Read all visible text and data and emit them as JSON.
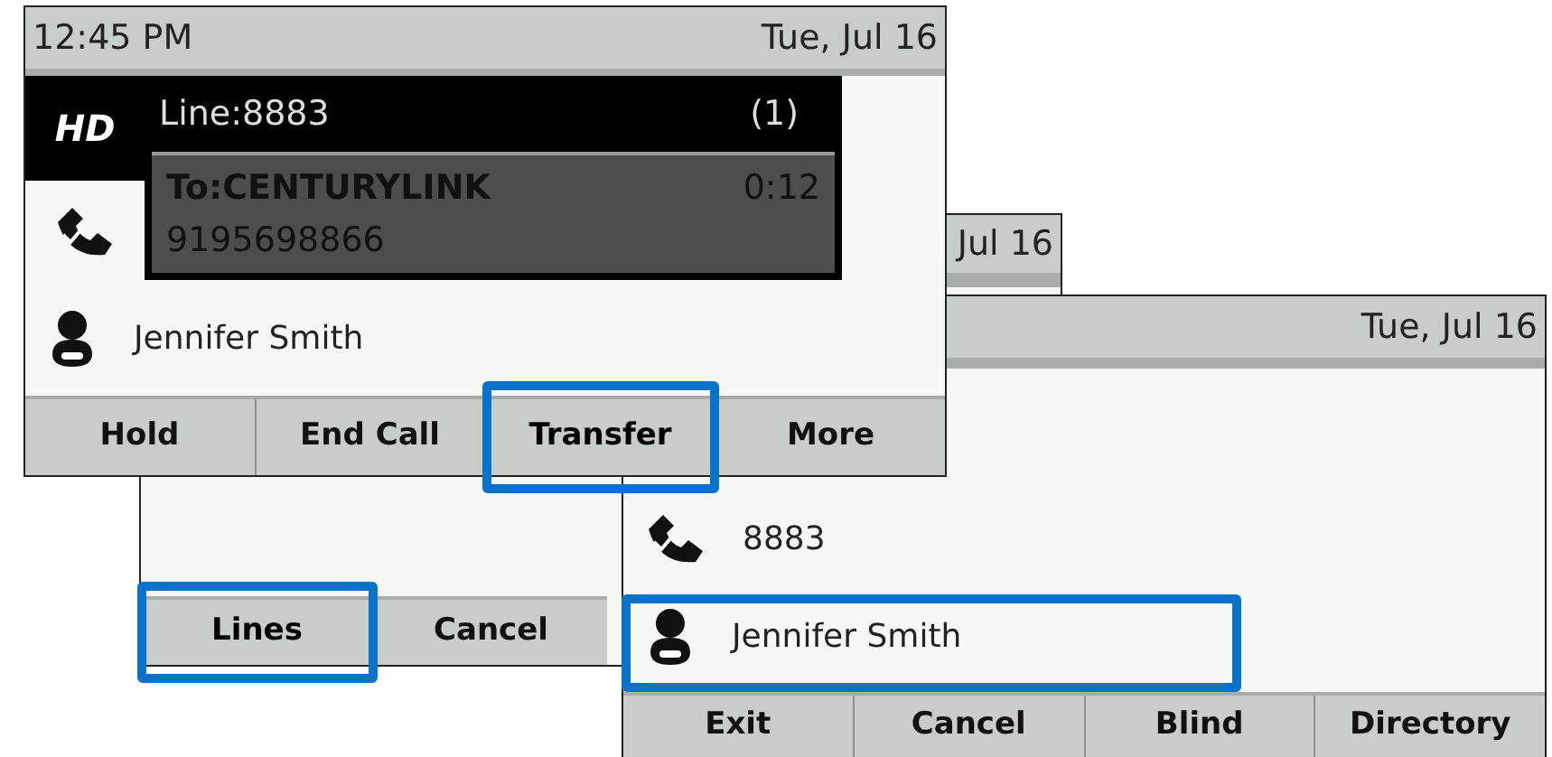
{
  "screens": [
    {
      "kind": "back",
      "header": {
        "date": "Jul 16"
      },
      "softkeys": [
        {
          "label": "Lines",
          "highlighted": true
        },
        {
          "label": "Cancel",
          "highlighted": false
        }
      ]
    },
    {
      "kind": "directory",
      "header": {
        "date": "Tue, Jul 16"
      },
      "entries": [
        {
          "kind": "line",
          "label": "8883",
          "highlighted": false
        },
        {
          "kind": "contact",
          "label": "Jennifer Smith",
          "highlighted": true
        }
      ],
      "softkeys": [
        {
          "label": "Exit",
          "highlighted": false
        },
        {
          "label": "Cancel",
          "highlighted": false
        },
        {
          "label": "Blind",
          "highlighted": false
        },
        {
          "label": "Directory",
          "highlighted": false
        }
      ]
    },
    {
      "kind": "call",
      "header": {
        "time": "12:45 PM",
        "date": "Tue, Jul 16"
      },
      "hd_badge": "HD",
      "line": {
        "label": "Line:8883",
        "count": "(1)"
      },
      "call": {
        "to": "To:CENTURYLINK",
        "duration": "0:12",
        "number": "9195698866"
      },
      "entries": [
        {
          "kind": "contact",
          "label": "Jennifer Smith",
          "highlighted": false
        }
      ],
      "softkeys": [
        {
          "label": "Hold",
          "highlighted": false
        },
        {
          "label": "End Call",
          "highlighted": false
        },
        {
          "label": "Transfer",
          "highlighted": true
        },
        {
          "label": "More",
          "highlighted": false
        }
      ]
    }
  ]
}
